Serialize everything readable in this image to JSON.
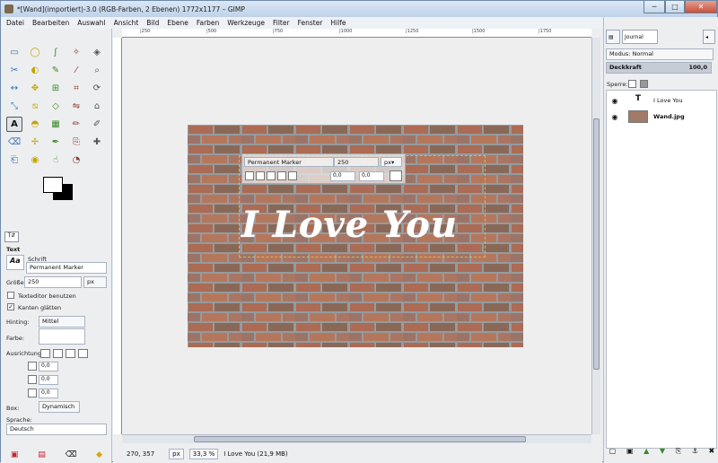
{
  "window": {
    "title": "*[Wand](importiert)-3.0 (RGB-Farben, 2 Ebenen) 1772x1177 – GIMP",
    "minimize": "─",
    "maximize": "□",
    "close": "✕"
  },
  "menu": [
    "Datei",
    "Bearbeiten",
    "Auswahl",
    "Ansicht",
    "Bild",
    "Ebene",
    "Farben",
    "Werkzeuge",
    "Filter",
    "Fenster",
    "Hilfe"
  ],
  "toolbox": {
    "tools": [
      "rect-select-icon",
      "ellipse-select-icon",
      "lasso-icon",
      "fuzzy-select-icon",
      "color-select-icon",
      "scissors-icon",
      "foreground-select-icon",
      "paths-icon",
      "color-picker-icon",
      "zoom-icon",
      "measure-icon",
      "move-icon",
      "align-icon",
      "crop-icon",
      "rotate-icon",
      "scale-icon",
      "shear-icon",
      "perspective-icon",
      "flip-icon",
      "cage-icon",
      "text-icon",
      "bucket-fill-icon",
      "blend-icon",
      "pencil-icon",
      "paintbrush-icon",
      "eraser-icon",
      "airbrush-icon",
      "ink-icon",
      "clone-icon",
      "heal-icon",
      "perspective-clone-icon",
      "blur-icon",
      "smudge-icon",
      "dodge-icon"
    ],
    "glyphs": [
      "▭",
      "◯",
      "ʃ",
      "✧",
      "◈",
      "✂",
      "◐",
      "✎",
      "⁄",
      "⌕",
      "↔",
      "✥",
      "⊞",
      "⌗",
      "⟳",
      "⤡",
      "⧅",
      "◇",
      "⇋",
      "⌂",
      "A",
      "◓",
      "▦",
      "✏",
      "✐",
      "⌫",
      "✢",
      "✒",
      "⎘",
      "✚",
      "⎗",
      "◉",
      "☝",
      "◔"
    ],
    "selected_index": 20,
    "tab": "T⇵",
    "options": {
      "section_title": "Text",
      "font_label": "Schrift",
      "font_preview": "Aa",
      "font_value": "Permanent Marker",
      "size_label": "Größe:",
      "size_value": "250",
      "size_unit": "px",
      "use_editor": "Texteditor benutzen",
      "antialias": "Kanten glätten",
      "hinting_label": "Hinting:",
      "hinting_value": "Mittel",
      "color_label": "Farbe:",
      "justify_label": "Ausrichtung:",
      "indent": "0,0",
      "line_spacing": "0,0",
      "letter_spacing": "0,0",
      "box_label": "Box:",
      "box_value": "Dynamisch",
      "language_label": "Sprache:",
      "language_value": "Deutsch"
    }
  },
  "canvas": {
    "ruler_labels": [
      "|250",
      "|500",
      "|750",
      "|1000",
      "|1250",
      "|1500",
      "|1750"
    ],
    "overlay_text": "I Love You",
    "text_panel": {
      "font": "Permanent Marker",
      "size": "250",
      "unit": "px▾",
      "baseline": "0,0",
      "kerning": "0,0"
    },
    "status": {
      "coords": "270, 357",
      "unit": "px",
      "zoom": "33,3 %",
      "info": "I Love You (21,9 MB)"
    }
  },
  "dock": {
    "tab_journal": "Journal",
    "mode_label": "Modus: Normal",
    "opacity_label": "Deckkraft",
    "opacity_value": "100,0",
    "lock_label": "Sperre:",
    "layers": [
      {
        "name": "I Love You",
        "type": "text"
      },
      {
        "name": "Wand.jpg",
        "type": "image"
      }
    ]
  },
  "colors": {
    "brand": "#7d6a4c",
    "text_white": "#ffffff"
  }
}
